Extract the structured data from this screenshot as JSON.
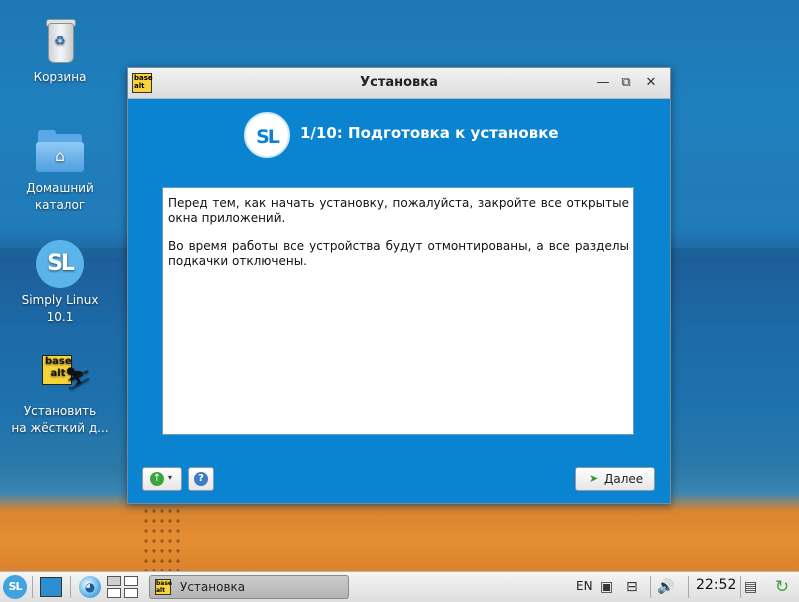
{
  "desktop": {
    "icons": [
      {
        "name": "trash",
        "label": "Корзина"
      },
      {
        "name": "home",
        "label": "Домашний\nкаталог"
      },
      {
        "name": "simply-linux",
        "label": "Simply Linux\n10.1"
      },
      {
        "name": "install",
        "label": "Установить\nна жёсткий д..."
      }
    ],
    "trash_symbol": "♻",
    "home_symbol": "⌂",
    "sl_text": "SL",
    "basealt_text": "base\nalt"
  },
  "window": {
    "title": "Установка",
    "logo_text": "base\nalt",
    "minimize_glyph": "—",
    "maximize_glyph": "⧉",
    "close_glyph": "✕",
    "header_logo_text": "SL",
    "step_title": "1/10: Подготовка к установке",
    "paragraphs": [
      "Перед тем, как начать установку, пожалуйста, закройте все открытые окна приложений.",
      "Во время работы все устройства будут отмонтированы, а все разделы подкачки отключены."
    ],
    "buttons": {
      "options_icon": "↑",
      "options_arrow": "▾",
      "help_icon": "?",
      "next_arrow": "➤",
      "next_label": "Далее"
    }
  },
  "taskbar": {
    "menu_text": "SL",
    "web_glyph": "◕",
    "task_logo_text": "base alt",
    "task_label": "Установка",
    "language": "EN",
    "net1_glyph": "▣",
    "net2_glyph": "⊟",
    "volume_glyph": "🔊",
    "clock": "22:52",
    "drive_glyph": "▤",
    "update_glyph": "↻"
  },
  "colors": {
    "window_bg": "#0a83d1",
    "accent": "#3ea3df",
    "sand": "#e58d32"
  }
}
